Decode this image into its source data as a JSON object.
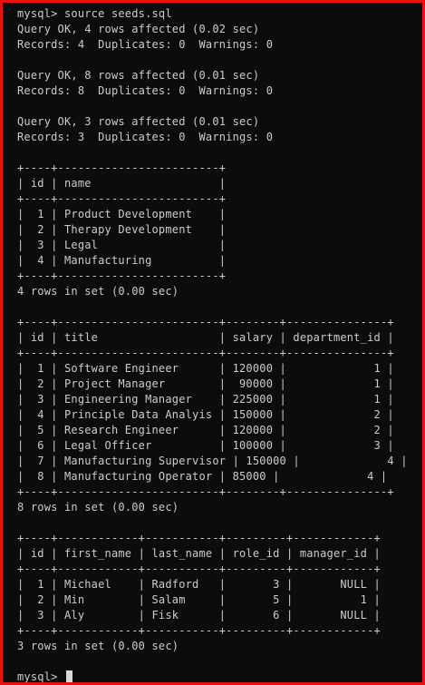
{
  "terminal": {
    "background": "#0c0c0c",
    "foreground": "#cccccc",
    "border_color": "#e81010",
    "lines": [
      "mysql> source seeds.sql",
      "Query OK, 4 rows affected (0.02 sec)",
      "Records: 4  Duplicates: 0  Warnings: 0",
      "",
      "Query OK, 8 rows affected (0.01 sec)",
      "Records: 8  Duplicates: 0  Warnings: 0",
      "",
      "Query OK, 3 rows affected (0.01 sec)",
      "Records: 3  Duplicates: 0  Warnings: 0",
      "",
      "+----+------------------------+",
      "| id | name                   |",
      "+----+------------------------+",
      "|  1 | Product Development    |",
      "|  2 | Therapy Development    |",
      "|  3 | Legal                  |",
      "|  4 | Manufacturing          |",
      "+----+------------------------+",
      "4 rows in set (0.00 sec)",
      "",
      "+----+------------------------+--------+---------------+",
      "| id | title                  | salary | department_id |",
      "+----+------------------------+--------+---------------+",
      "|  1 | Software Engineer      | 120000 |             1 |",
      "|  2 | Project Manager        |  90000 |             1 |",
      "|  3 | Engineering Manager    | 225000 |             1 |",
      "|  4 | Principle Data Analyis | 150000 |             2 |",
      "|  5 | Research Engineer      | 120000 |             2 |",
      "|  6 | Legal Officer          | 100000 |             3 |",
      "|  7 | Manufacturing Supervisor | 150000 |             4 |",
      "|  8 | Manufacturing Operator | 85000 |             4 |",
      "+----+------------------------+--------+---------------+",
      "8 rows in set (0.00 sec)",
      "",
      "+----+------------+-----------+---------+------------+",
      "| id | first_name | last_name | role_id | manager_id |",
      "+----+------------+-----------+---------+------------+",
      "|  1 | Michael    | Radford   |       3 |       NULL |",
      "|  2 | Min        | Salam     |       5 |          1 |",
      "|  3 | Aly        | Fisk      |       6 |       NULL |",
      "+----+------------+-----------+---------+------------+",
      "3 rows in set (0.00 sec)",
      ""
    ],
    "prompt": "mysql> "
  }
}
